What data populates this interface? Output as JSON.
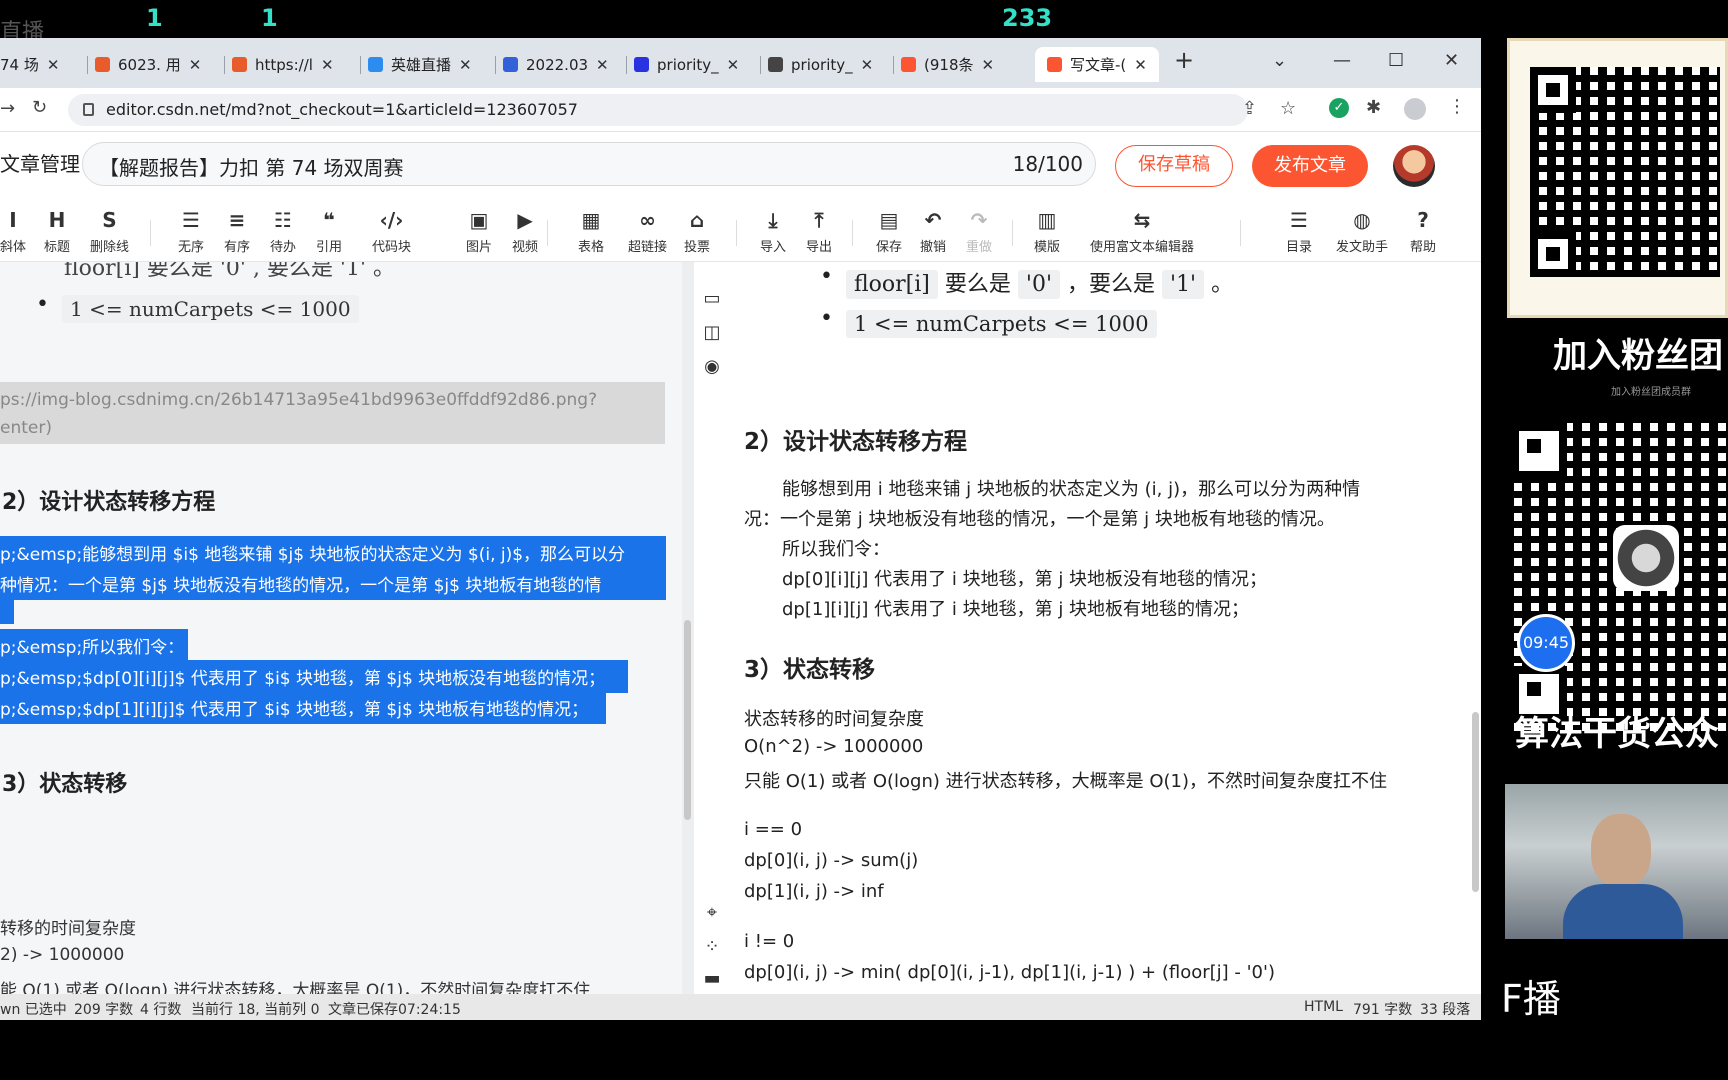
{
  "overlay": {
    "num1": "1",
    "num2": "1",
    "viewers": "233",
    "corner": "直播"
  },
  "tabs": [
    {
      "label": "74 场",
      "color": "#888"
    },
    {
      "label": "6023. 用",
      "color": "#e85b2a"
    },
    {
      "label": "https://l",
      "color": "#e85b2a"
    },
    {
      "label": "英雄直播",
      "color": "#2d8cf0"
    },
    {
      "label": "2022.03",
      "color": "#3361d8"
    },
    {
      "label": "priority_",
      "color": "#2932e1"
    },
    {
      "label": "priority_",
      "color": "#444"
    },
    {
      "label": "(918条",
      "color": "#fc5531"
    },
    {
      "label": "写文章-(",
      "color": "#fc5531"
    }
  ],
  "browser": {
    "url": "editor.csdn.net/md?not_checkout=1&articleId=123607057",
    "new_tab": "+",
    "win_chevron": "⌄",
    "win_min": "—",
    "win_max": "☐",
    "win_close": "✕"
  },
  "editor": {
    "manage_label": "文章管理",
    "title": "【解题报告】力扣 第 74 场双周赛",
    "title_count": "18/100",
    "save_draft": "保存草稿",
    "publish": "发布文章"
  },
  "toolbar": [
    {
      "glyph": "I",
      "label": "斜体"
    },
    {
      "glyph": "H",
      "label": "标题"
    },
    {
      "glyph": "S",
      "label": "删除线"
    },
    {
      "glyph": "☰",
      "label": "无序"
    },
    {
      "glyph": "≡",
      "label": "有序"
    },
    {
      "glyph": "☷",
      "label": "待办"
    },
    {
      "glyph": "❝",
      "label": "引用"
    },
    {
      "glyph": "‹/›",
      "label": "代码块"
    },
    {
      "glyph": "▣",
      "label": "图片"
    },
    {
      "glyph": "▶",
      "label": "视频"
    },
    {
      "glyph": "▦",
      "label": "表格"
    },
    {
      "glyph": "∞",
      "label": "超链接"
    },
    {
      "glyph": "⌂",
      "label": "投票"
    },
    {
      "glyph": "⤓",
      "label": "导入"
    },
    {
      "glyph": "⤒",
      "label": "导出"
    },
    {
      "glyph": "▤",
      "label": "保存"
    },
    {
      "glyph": "↶",
      "label": "撤销"
    },
    {
      "glyph": "↷",
      "label": "重做"
    },
    {
      "glyph": "▥",
      "label": "模版"
    },
    {
      "glyph": "⇆",
      "label": "使用富文本编辑器"
    },
    {
      "glyph": "☰",
      "label": "目录"
    },
    {
      "glyph": "◍",
      "label": "发文助手"
    },
    {
      "glyph": "?",
      "label": "帮助"
    }
  ],
  "left": {
    "top_partial": "floor[i]  要么是  '0'  , 要么是  '1'  。",
    "bullet": "1 <= numCarpets <= 1000",
    "img_line1": "ps://img-blog.csdnimg.cn/26b14713a95e41bd9963e0ffddf92d86.png?",
    "img_line2": "enter)",
    "h_design": "2）设计状态转移方程",
    "sel1": "p;&emsp;能够想到用 $i$ 地毯来铺 $j$ 块地板的状态定义为 $(i, j)$，那么可以分",
    "sel2": "种情况：一个是第 $j$ 块地板没有地毯的情况，一个是第 $j$ 块地板有地毯的情",
    "sel3": "p;&emsp;所以我们令：",
    "sel4": "p;&emsp;$dp[0][i][j]$ 代表用了 $i$ 块地毯，第 $j$ 块地板没有地毯的情况；",
    "sel5": "p;&emsp;$dp[1][i][j]$ 代表用了 $i$ 块地毯，第 $j$ 块地板有地毯的情况；",
    "h_trans": "3）状态转移",
    "c1": "转移的时间复杂度",
    "c2": "2) -> 1000000",
    "c3": "能 O(1) 或者 O(logn) 进行状态转移，大概率是 O(1)，不然时间复杂度扛不住"
  },
  "right": {
    "b1_code": "floor[i]",
    "b1_mid": "要么是",
    "b1_c2": "'0'",
    "b1_mid2": "，要么是",
    "b1_c3": "'1'",
    "b1_end": "。",
    "b2": "1 <= numCarpets <= 1000",
    "h_design": "2）设计状态转移方程",
    "p1": "能够想到用 i 地毯来铺 j 块地板的状态定义为 (i, j)，那么可以分为两种情",
    "p2": "况：一个是第 j 块地板没有地毯的情况，一个是第 j 块地板有地毯的情况。",
    "p3": "所以我们令：",
    "p4": "dp[0][i][j] 代表用了 i 块地毯，第 j 块地板没有地毯的情况；",
    "p5": "dp[1][i][j] 代表用了 i 块地毯，第 j 块地板有地毯的情况；",
    "h_trans": "3）状态转移",
    "t1": "状态转移的时间复杂度",
    "t2": "O(n^2) -> 1000000",
    "t3": "只能 O(1) 或者 O(logn) 进行状态转移，大概率是 O(1)，不然时间复杂度扛不住",
    "t4": "i == 0",
    "t5": "dp[0](i, j) -> sum(j)",
    "t6": "dp[1](i, j) -> inf",
    "t7": "i != 0",
    "t8": "dp[0](i, j) -> min( dp[0](i, j-1), dp[1](i, j-1) ) + (floor[j] - '0')"
  },
  "status": {
    "left": "wn 已选中",
    "chars": "209 字数",
    "lines": "4 行数",
    "cursor": "当前行 18, 当前列 0",
    "saved": "文章已保存07:24:15",
    "mode": "HTML",
    "r_chars": "791 字数",
    "paras": "33 段落"
  },
  "stream": {
    "fans": "加入粉丝团",
    "small": "加入粉丝团成员群",
    "timer": "09:45",
    "algo": "算法干货公众",
    "live": "F播"
  }
}
